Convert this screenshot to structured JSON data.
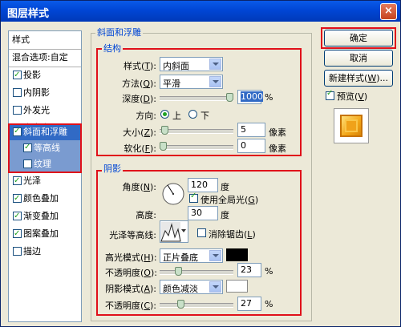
{
  "window": {
    "title": "图层样式",
    "close_glyph": "×"
  },
  "left_list": {
    "header": "样式",
    "blend": "混合选项:自定",
    "items": [
      {
        "label": "投影",
        "checked": true
      },
      {
        "label": "内阴影",
        "checked": false
      },
      {
        "label": "外发光",
        "checked": false
      },
      {
        "label": "内发光",
        "checked": false
      },
      {
        "label": "斜面和浮雕",
        "checked": true
      },
      {
        "label": "等高线",
        "checked": true
      },
      {
        "label": "纹理",
        "checked": false
      },
      {
        "label": "光泽",
        "checked": true
      },
      {
        "label": "颜色叠加",
        "checked": true
      },
      {
        "label": "渐变叠加",
        "checked": true
      },
      {
        "label": "图案叠加",
        "checked": true
      },
      {
        "label": "描边",
        "checked": false
      }
    ]
  },
  "bevel": {
    "group_title": "斜面和浮雕",
    "struct_title": "结构",
    "style": {
      "label": "样式(",
      "key": "T",
      "end": "):",
      "value": "内斜面"
    },
    "technique": {
      "label": "方法(",
      "key": "Q",
      "end": "):",
      "value": "平滑"
    },
    "depth": {
      "label": "深度(",
      "key": "D",
      "end": "):",
      "value": "1000",
      "unit": "%",
      "level": 1.0
    },
    "direction": {
      "label": "方向:",
      "up": "上",
      "down": "下",
      "selected": "up"
    },
    "size": {
      "label": "大小(",
      "key": "Z",
      "end": "):",
      "value": "5",
      "unit": "像素",
      "level": 0.02
    },
    "soften": {
      "label": "软化(",
      "key": "F",
      "end": "):",
      "value": "0",
      "unit": "像素",
      "level": 0.0
    }
  },
  "shading": {
    "title": "阴影",
    "angle": {
      "label": "角度(",
      "key": "N",
      "end": "):",
      "value": "120",
      "unit": "度"
    },
    "global_light": {
      "label": "使用全局光(",
      "key": "G",
      "end": ")",
      "checked": true
    },
    "altitude": {
      "label": "高度:",
      "value": "30",
      "unit": "度"
    },
    "gloss": {
      "label": "光泽等高线:",
      "anti_alias": "消除锯齿(",
      "anti_key": "L",
      "anti_end": ")",
      "anti_checked": false
    },
    "highlight": {
      "label": "高光模式(",
      "key": "H",
      "end": "):",
      "value": "正片叠底",
      "color": "#000000"
    },
    "highlight_opacity": {
      "label": "不透明度(",
      "key": "O",
      "end": "):",
      "value": "23",
      "unit": "%",
      "level": 0.23
    },
    "shadow": {
      "label": "阴影模式(",
      "key": "A",
      "end": "):",
      "value": "颜色减淡",
      "color": "#ffffff"
    },
    "shadow_opacity": {
      "label": "不透明度(",
      "key": "C",
      "end": "):",
      "value": "27",
      "unit": "%",
      "level": 0.27
    }
  },
  "buttons": {
    "ok": "确定",
    "cancel": "取消",
    "new_style": "新建样式(",
    "new_style_key": "W",
    "new_style_end": ")...",
    "preview": "预览(",
    "preview_key": "V",
    "preview_end": ")",
    "preview_checked": true
  },
  "colors": {
    "accent": "#0046d5",
    "highlight_box": "#e0101a",
    "selection": "#316ac5"
  }
}
